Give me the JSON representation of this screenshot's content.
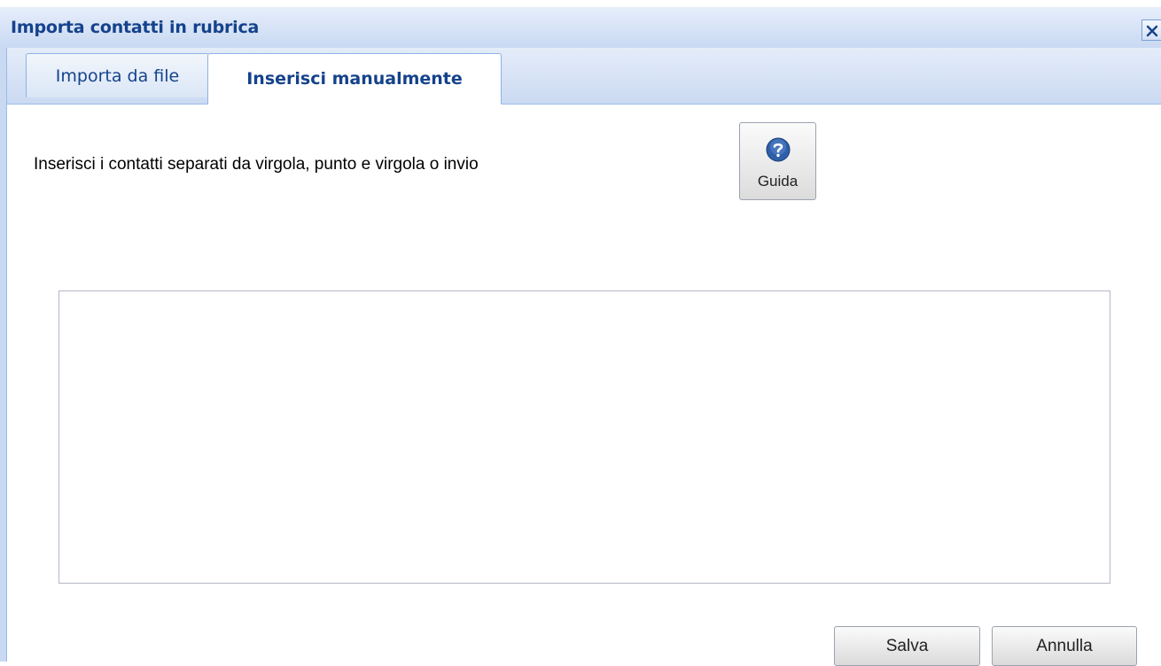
{
  "dialog": {
    "title": "Importa contatti in rubrica",
    "close_icon": "close-icon"
  },
  "tabs": [
    {
      "label": "Importa da file",
      "active": false
    },
    {
      "label": "Inserisci manualmente",
      "active": true
    }
  ],
  "content": {
    "instruction": "Inserisci i contatti separati da virgola, punto e virgola o invio",
    "help_button": {
      "label": "Guida",
      "icon": "help-icon"
    },
    "contacts_value": "",
    "contacts_placeholder": ""
  },
  "footer": {
    "save_label": "Salva",
    "cancel_label": "Annulla"
  },
  "colors": {
    "title_text": "#15428b",
    "header_bg": "#c9d9f2",
    "border": "#99bbe8",
    "help_icon": "#2f5fa8"
  }
}
